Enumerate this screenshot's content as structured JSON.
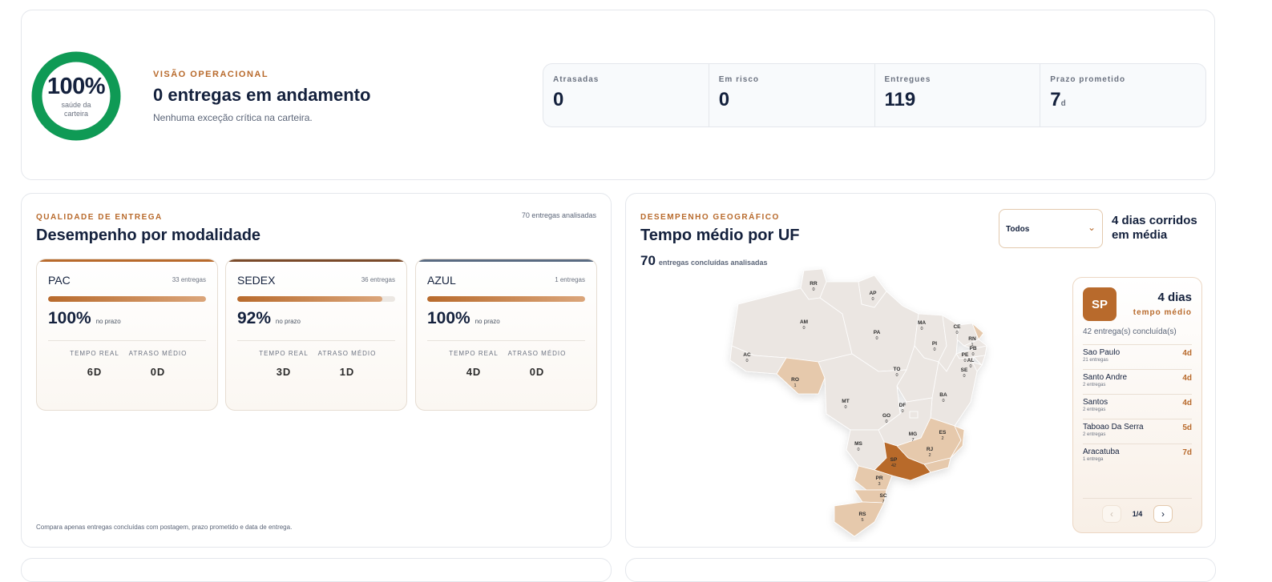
{
  "overview": {
    "health_value": "100%",
    "health_fraction": 1.0,
    "health_label": "saúde da carteira",
    "eyebrow": "VISÃO OPERACIONAL",
    "title": "0 entregas em andamento",
    "subtitle": "Nenhuma exceção crítica na carteira.",
    "kpis": [
      {
        "label": "Atrasadas",
        "value": "0",
        "unit": ""
      },
      {
        "label": "Em risco",
        "value": "0",
        "unit": ""
      },
      {
        "label": "Entregues",
        "value": "119",
        "unit": ""
      },
      {
        "label": "Prazo prometido",
        "value": "7",
        "unit": "d"
      }
    ]
  },
  "quality": {
    "eyebrow": "QUALIDADE DE ENTREGA",
    "title": "Desempenho por modalidade",
    "count": "70 entregas analisadas",
    "footer": "Compara apenas entregas concluídas com postagem, prazo prometido e data de entrega.",
    "stat_label_real": "TEMPO REAL",
    "stat_label_delay": "ATRASO MÉDIO",
    "modes": [
      {
        "name": "PAC",
        "count": "33 entregas",
        "pct": "100%",
        "pct_value": 100,
        "pct_suffix": "no prazo",
        "real": "6D",
        "delay": "0D",
        "accent": "#b86a2c"
      },
      {
        "name": "SEDEX",
        "count": "36 entregas",
        "pct": "92%",
        "pct_value": 92,
        "pct_suffix": "no prazo",
        "real": "3D",
        "delay": "1D",
        "accent": "#7a4a2a"
      },
      {
        "name": "AZUL",
        "count": "1 entregas",
        "pct": "100%",
        "pct_value": 100,
        "pct_suffix": "no prazo",
        "real": "4D",
        "delay": "0D",
        "accent": "#5a6b82"
      }
    ]
  },
  "geo": {
    "eyebrow": "DESEMPENHO GEOGRÁFICO",
    "title": "Tempo médio por UF",
    "count": "70",
    "count_label": "entregas concluídas analisadas",
    "filter_value": "Todos",
    "avg_text": "4 dias corridos em média",
    "states": [
      {
        "uf": "RR",
        "count": "0"
      },
      {
        "uf": "AP",
        "count": "0"
      },
      {
        "uf": "AM",
        "count": "0"
      },
      {
        "uf": "PA",
        "count": "0"
      },
      {
        "uf": "MA",
        "count": "0"
      },
      {
        "uf": "CE",
        "count": "0"
      },
      {
        "uf": "RN",
        "count": "1"
      },
      {
        "uf": "PB",
        "count": "0"
      },
      {
        "uf": "PE",
        "count": "0"
      },
      {
        "uf": "AL",
        "count": "0"
      },
      {
        "uf": "SE",
        "count": "0"
      },
      {
        "uf": "PI",
        "count": "0"
      },
      {
        "uf": "AC",
        "count": "0"
      },
      {
        "uf": "RO",
        "count": "1"
      },
      {
        "uf": "TO",
        "count": "0"
      },
      {
        "uf": "BA",
        "count": "0"
      },
      {
        "uf": "MT",
        "count": "0"
      },
      {
        "uf": "DF",
        "count": "0"
      },
      {
        "uf": "GO",
        "count": "0"
      },
      {
        "uf": "MG",
        "count": "7"
      },
      {
        "uf": "ES",
        "count": "2"
      },
      {
        "uf": "MS",
        "count": "0"
      },
      {
        "uf": "RJ",
        "count": "2"
      },
      {
        "uf": "SP",
        "count": "42"
      },
      {
        "uf": "PR",
        "count": "3"
      },
      {
        "uf": "SC",
        "count": "7"
      },
      {
        "uf": "RS",
        "count": "5"
      }
    ],
    "colors": {
      "empty": "#ebe6e2",
      "low": "#e6c9ac",
      "high": "#b86a2c"
    },
    "panel": {
      "uf": "SP",
      "days": "4 dias",
      "avg_label": "tempo médio",
      "sub": "42 entrega(s) concluída(s)",
      "cities": [
        {
          "name": "Sao Paulo",
          "count": "21 entregas",
          "days": "4d"
        },
        {
          "name": "Santo Andre",
          "count": "2 entregas",
          "days": "4d"
        },
        {
          "name": "Santos",
          "count": "2 entregas",
          "days": "4d"
        },
        {
          "name": "Taboao Da Serra",
          "count": "2 entregas",
          "days": "5d"
        },
        {
          "name": "Aracatuba",
          "count": "1 entrega",
          "days": "7d"
        }
      ],
      "page": "1/4"
    }
  }
}
